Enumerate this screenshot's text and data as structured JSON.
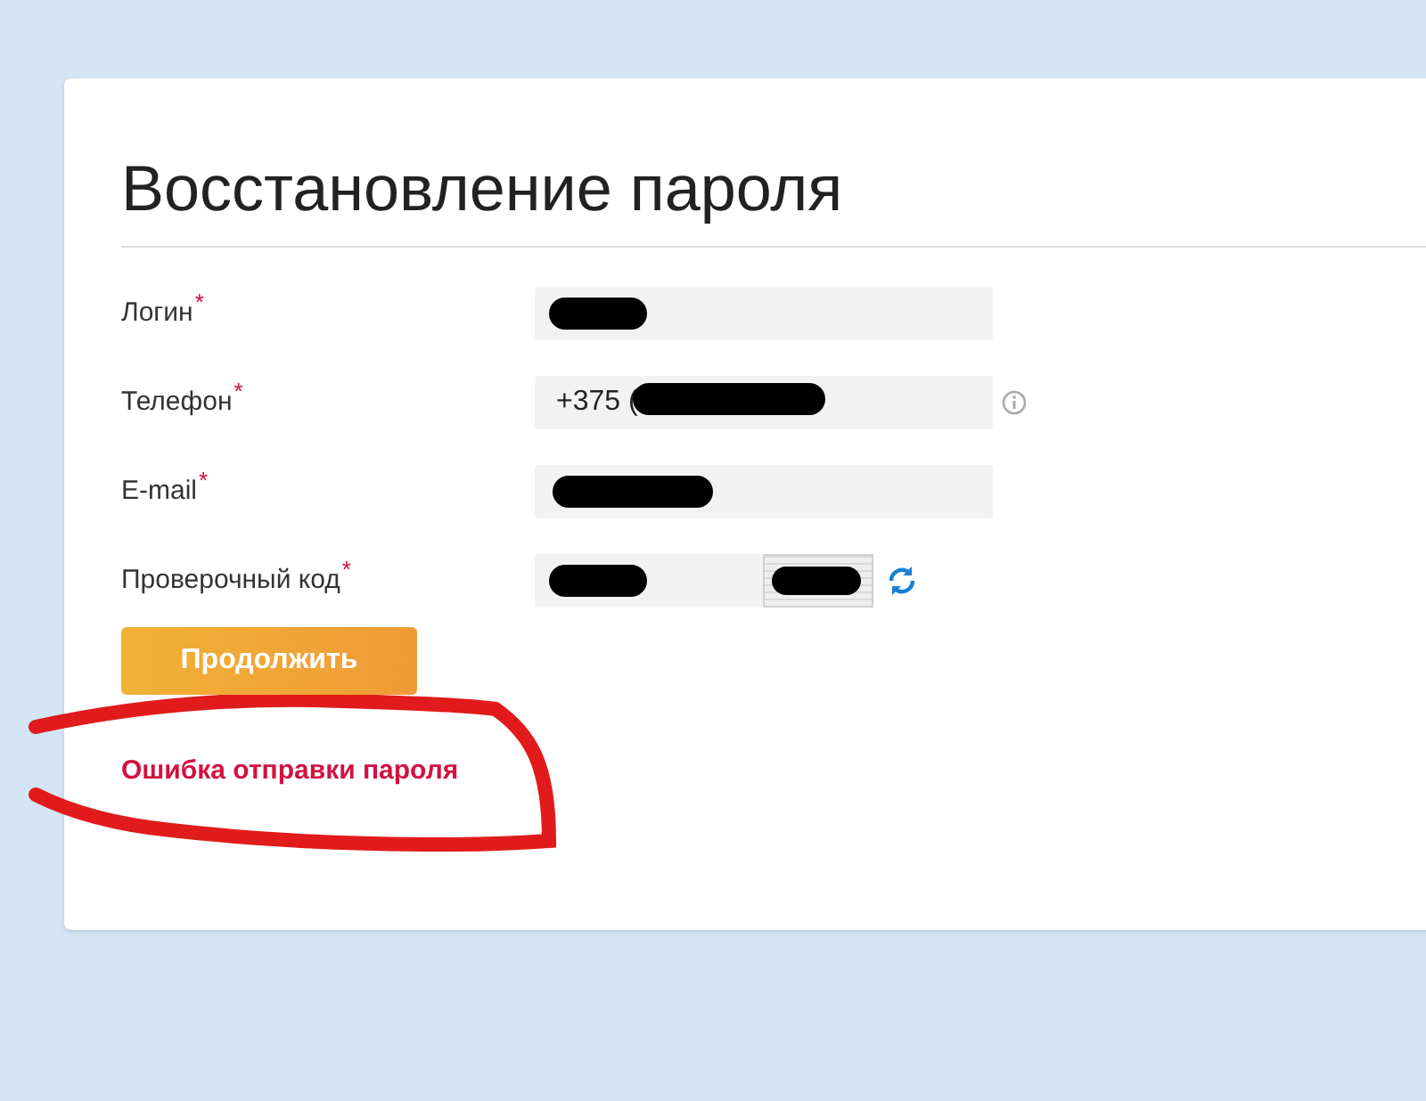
{
  "title": "Восстановление пароля",
  "fields": [
    {
      "kind": "text",
      "label": "Логин",
      "required_mark": "*",
      "redacted": true
    },
    {
      "kind": "text",
      "label": "Телефон",
      "required_mark": "*",
      "value": "+375 (",
      "redacted": true,
      "info": true
    },
    {
      "kind": "text",
      "label": "E-mail",
      "required_mark": "*",
      "redacted": true
    },
    {
      "kind": "captcha",
      "label": "Проверочный код",
      "required_mark": "*",
      "redacted": true
    }
  ],
  "submit": "Продолжить",
  "error": {
    "text": "Ошибка отправки пароля",
    "circled": true
  }
}
